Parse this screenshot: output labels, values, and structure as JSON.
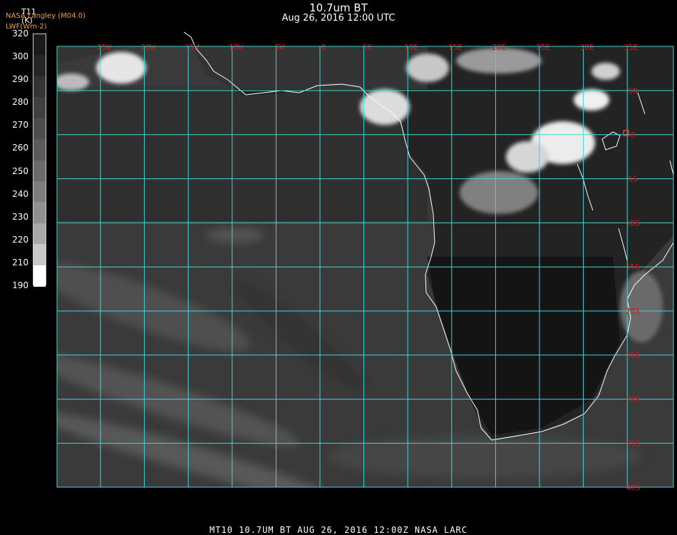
{
  "header": {
    "title": "10.7um BT",
    "subtitle": "Aug 26, 2016 12:00 UTC"
  },
  "organization": {
    "line1": "NASA Langley (M04.0)",
    "line2": "LWF(Wm-2)"
  },
  "colorbar": {
    "variable": "T11",
    "unit": "(K)",
    "ticks": [
      "320",
      "300",
      "290",
      "280",
      "270",
      "260",
      "250",
      "240",
      "230",
      "220",
      "210",
      "190"
    ],
    "colors": [
      "#1a1a1a",
      "#262626",
      "#333333",
      "#404040",
      "#4d4d4d",
      "#5a5a5a",
      "#6b6b6b",
      "#7d7d7d",
      "#909090",
      "#a8a8a8",
      "#c8c8c8",
      "#ffffff"
    ]
  },
  "map": {
    "longitude_labels": [
      "25W",
      "20W",
      "15W",
      "10W",
      "5W",
      "0",
      "5E",
      "10E",
      "15E",
      "20E",
      "25E",
      "30E",
      "35E"
    ],
    "latitude_labels": [
      "5N",
      "0",
      "5S",
      "10S",
      "15S",
      "20S",
      "25S",
      "30S",
      "35S",
      "40S"
    ],
    "grid_color": "#3fd7d7",
    "label_color": "#d81818",
    "coast_color": "#ffffff"
  },
  "footer": {
    "text": "MT10  10.7UM BT   AUG 26, 2016 12:00Z   NASA LARC"
  }
}
